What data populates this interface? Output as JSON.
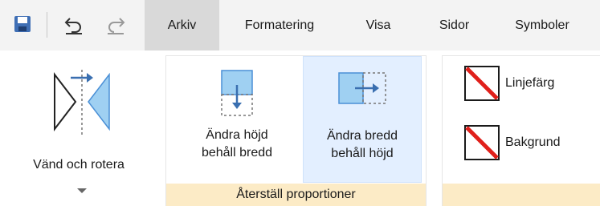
{
  "quick_access": {
    "save_icon": "save-icon",
    "undo_icon": "undo-icon",
    "redo_icon": "redo-icon"
  },
  "tabs": [
    {
      "label": "Arkiv",
      "active": true
    },
    {
      "label": "Formatering",
      "active": false
    },
    {
      "label": "Visa",
      "active": false
    },
    {
      "label": "Sidor",
      "active": false
    },
    {
      "label": "Symboler",
      "active": false
    }
  ],
  "ribbon": {
    "vand": {
      "label": "Vänd och rotera",
      "icon": "flip-icon"
    },
    "proportion_group": {
      "footer": "Återställ proportioner",
      "height_btn": {
        "line1": "Ändra höjd",
        "line2": "behåll bredd",
        "icon": "change-height-icon"
      },
      "width_btn": {
        "line1": "Ändra bredd",
        "line2": "behåll höjd",
        "icon": "change-width-icon"
      }
    },
    "style_group": {
      "line_color": {
        "label": "Linjefärg",
        "icon": "line-color-icon"
      },
      "background": {
        "label": "Bakgrund",
        "icon": "background-color-icon"
      }
    }
  },
  "colors": {
    "accent_blue": "#4a8fd6",
    "light_blue": "#9fd0f2",
    "slash_red": "#e0201b",
    "footer": "#fcebc6",
    "active_tab": "#d9d9d9"
  }
}
